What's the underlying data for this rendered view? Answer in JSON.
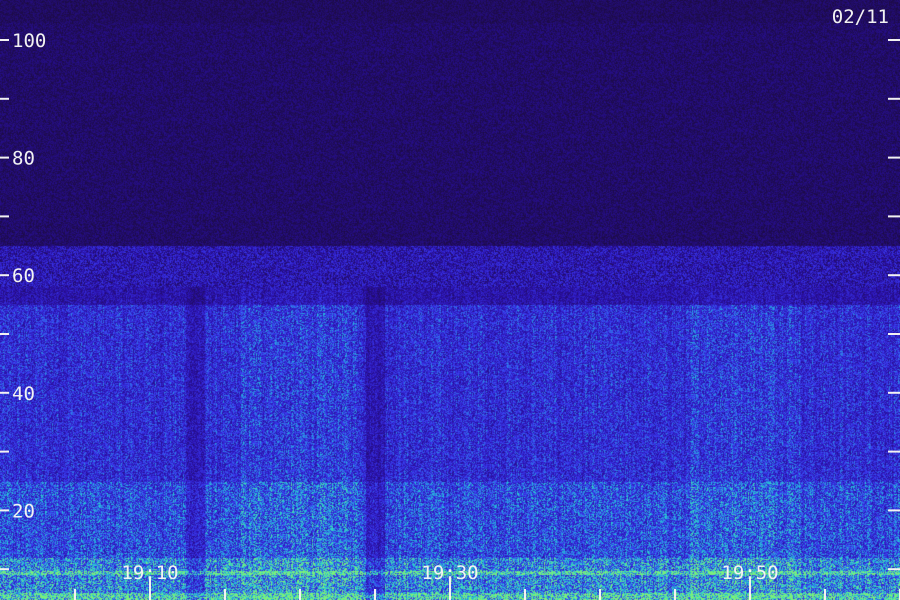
{
  "date_label": "02/11",
  "chart_data": {
    "type": "heatmap",
    "title": "",
    "xlabel": "",
    "ylabel": "",
    "x_range": [
      "19:02",
      "20:02"
    ],
    "y_range": [
      0,
      103
    ],
    "x_tick_labels": [
      {
        "value": "19:10"
      },
      {
        "value": "19:30"
      },
      {
        "value": "19:50"
      }
    ],
    "x_minor_ticks": [
      "19:05",
      "19:10",
      "19:15",
      "19:20",
      "19:25",
      "19:30",
      "19:35",
      "19:40",
      "19:45",
      "19:50",
      "19:55",
      "20:00"
    ],
    "y_tick_labels": [
      {
        "value": 20,
        "text": "20"
      },
      {
        "value": 40,
        "text": "40"
      },
      {
        "value": 60,
        "text": "60"
      },
      {
        "value": 80,
        "text": "80"
      },
      {
        "value": 100,
        "text": "100"
      }
    ],
    "y_minor_ticks": [
      10,
      30,
      50,
      70,
      90
    ],
    "colormap": [
      "#1a0a33",
      "#2a10a8",
      "#3a3af0",
      "#22c8d8",
      "#7cf07a"
    ],
    "intensity_profile": {
      "description_free": true,
      "bands": [
        {
          "y": [
            0,
            4
          ],
          "level": 0.85
        },
        {
          "y": [
            4,
            6
          ],
          "level": 0.95
        },
        {
          "y": [
            6,
            12
          ],
          "level": 0.7
        },
        {
          "y": [
            12,
            25
          ],
          "level": 0.55
        },
        {
          "y": [
            25,
            55
          ],
          "level": 0.45
        },
        {
          "y": [
            55,
            65
          ],
          "level": 0.3
        },
        {
          "y": [
            65,
            103
          ],
          "level": 0.12
        }
      ],
      "bright_lines": [
        1.5,
        5.5,
        9.5
      ]
    }
  }
}
